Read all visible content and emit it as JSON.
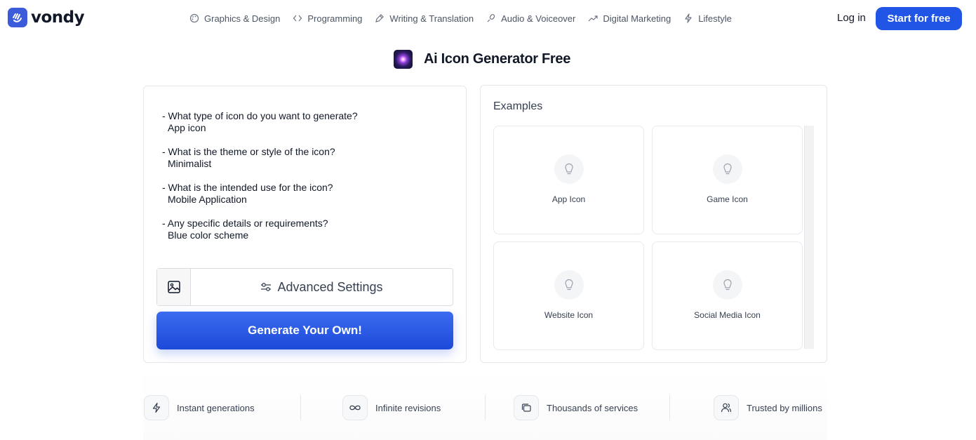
{
  "brand": {
    "name": "vondy",
    "accent": "#2155e5"
  },
  "nav": {
    "items": [
      {
        "label": "Graphics & Design",
        "icon": "palette-icon"
      },
      {
        "label": "Programming",
        "icon": "code-icon"
      },
      {
        "label": "Writing & Translation",
        "icon": "pen-icon"
      },
      {
        "label": "Audio & Voiceover",
        "icon": "microphone-icon"
      },
      {
        "label": "Digital Marketing",
        "icon": "trend-up-icon"
      },
      {
        "label": "Lifestyle",
        "icon": "lightning-icon"
      }
    ],
    "login": "Log in",
    "start": "Start for free"
  },
  "page": {
    "title": "Ai Icon Generator Free"
  },
  "prompt": {
    "items": [
      {
        "q": "- What type of icon do you want to generate?",
        "a": "App icon"
      },
      {
        "q": "- What is the theme or style of the icon?",
        "a": "Minimalist"
      },
      {
        "q": "- What is the intended use for the icon?",
        "a": "Mobile Application"
      },
      {
        "q": "- Any specific details or requirements?",
        "a": "Blue color scheme"
      }
    ]
  },
  "controls": {
    "advanced_settings": "Advanced Settings",
    "generate": "Generate Your Own!"
  },
  "examples": {
    "title": "Examples",
    "cards": [
      {
        "label": "App Icon",
        "icon": "lightbulb-icon"
      },
      {
        "label": "Game Icon",
        "icon": "lightbulb-icon"
      },
      {
        "label": "Website Icon",
        "icon": "lightbulb-icon"
      },
      {
        "label": "Social Media Icon",
        "icon": "lightbulb-icon"
      }
    ]
  },
  "features": [
    {
      "label": "Instant generations",
      "icon": "lightning-icon"
    },
    {
      "label": "Infinite revisions",
      "icon": "infinity-icon"
    },
    {
      "label": "Thousands of services",
      "icon": "layers-icon"
    },
    {
      "label": "Trusted by millions",
      "icon": "users-icon"
    }
  ]
}
